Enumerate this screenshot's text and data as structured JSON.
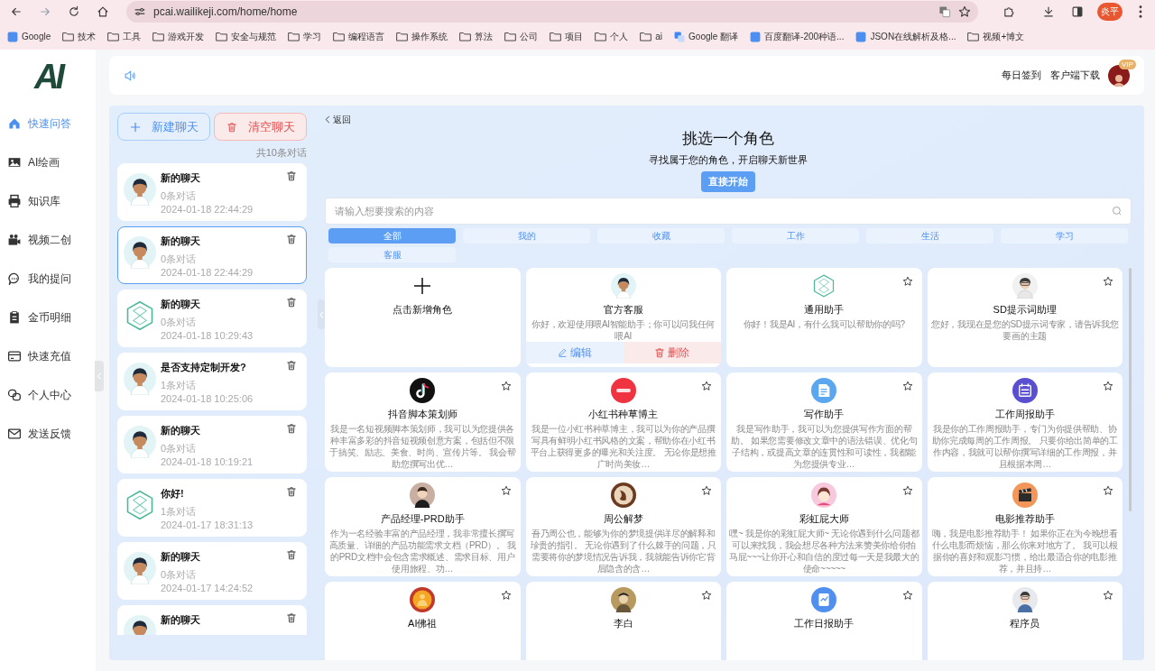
{
  "browser": {
    "url": "pcai.wailikeji.com/home/home",
    "profile": "炎平",
    "bookmarks": [
      {
        "kind": "site",
        "label": "Google"
      },
      {
        "kind": "folder",
        "label": "技术"
      },
      {
        "kind": "folder",
        "label": "工具"
      },
      {
        "kind": "folder",
        "label": "游戏开发"
      },
      {
        "kind": "folder",
        "label": "安全与规范"
      },
      {
        "kind": "folder",
        "label": "学习"
      },
      {
        "kind": "folder",
        "label": "编程语言"
      },
      {
        "kind": "folder",
        "label": "操作系统"
      },
      {
        "kind": "folder",
        "label": "算法"
      },
      {
        "kind": "folder",
        "label": "公司"
      },
      {
        "kind": "folder",
        "label": "项目"
      },
      {
        "kind": "folder",
        "label": "个人"
      },
      {
        "kind": "folder",
        "label": "ai"
      },
      {
        "kind": "translate",
        "label": "Google 翻译"
      },
      {
        "kind": "site",
        "label": "百度翻译-200种语..."
      },
      {
        "kind": "site",
        "label": "JSON在线解析及格..."
      },
      {
        "kind": "folder",
        "label": "视频+博文"
      }
    ]
  },
  "logo": "AI",
  "sidebar": {
    "items": [
      {
        "label": "快速问答",
        "selected": true
      },
      {
        "label": "AI绘画",
        "selected": false
      },
      {
        "label": "知识库",
        "selected": false
      },
      {
        "label": "视频二创",
        "selected": false
      },
      {
        "label": "我的提问",
        "selected": false
      },
      {
        "label": "金币明细",
        "selected": false
      },
      {
        "label": "快速充值",
        "selected": false
      },
      {
        "label": "个人中心",
        "selected": false
      },
      {
        "label": "发送反馈",
        "selected": false
      }
    ]
  },
  "header": {
    "links": [
      "每日签到",
      "客户端下载"
    ],
    "badge": "VIP"
  },
  "chats": {
    "new_button": "新建聊天",
    "clear_button": "清空聊天",
    "count": "共10条对话",
    "items": [
      {
        "title": "新的聊天",
        "messages": "0条对话",
        "time": "2024-01-18 22:44:29",
        "selected": false
      },
      {
        "title": "新的聊天",
        "messages": "0条对话",
        "time": "2024-01-18 22:44:29",
        "selected": true
      },
      {
        "title": "新的聊天",
        "messages": "0条对话",
        "time": "2024-01-18 10:29:43",
        "selected": false
      },
      {
        "title": "是否支持定制开发?",
        "messages": "1条对话",
        "time": "2024-01-18 10:25:06",
        "selected": false
      },
      {
        "title": "新的聊天",
        "messages": "0条对话",
        "time": "2024-01-18 10:19:21",
        "selected": false
      },
      {
        "title": "你好!",
        "messages": "1条对话",
        "time": "2024-01-17 18:31:13",
        "selected": false
      },
      {
        "title": "新的聊天",
        "messages": "0条对话",
        "time": "2024-01-17 14:24:52",
        "selected": false
      },
      {
        "title": "新的聊天",
        "selected": false
      }
    ]
  },
  "roles": {
    "back": "返回",
    "title": "挑选一个角色",
    "subtitle": "寻找属于您的角色，开启聊天新世界",
    "start_button": "直接开始",
    "search": {
      "placeholder": "请输入想要搜索的内容"
    },
    "tabs": [
      {
        "label": "全部",
        "selected": true
      },
      {
        "label": "我的",
        "selected": false
      },
      {
        "label": "收藏",
        "selected": false
      },
      {
        "label": "工作",
        "selected": false
      },
      {
        "label": "生活",
        "selected": false
      },
      {
        "label": "学习",
        "selected": false
      },
      {
        "label": "客服",
        "selected": false
      }
    ],
    "cards": [
      {
        "kind": "add",
        "title": "点击新增角色"
      },
      {
        "kind": "role",
        "title": "官方客服",
        "description": "你好，欢迎使用喂AI智能助手；你可以问我任何喂AI",
        "hovered": true,
        "actions": [
          "编辑",
          "删除"
        ]
      },
      {
        "kind": "role",
        "title": "通用助手",
        "description": "你好！我是AI，有什么我可以帮助你的吗?",
        "hovered": false
      },
      {
        "kind": "role",
        "title": "SD提示词助理",
        "description": "您好，我现在是您的SD提示词专家，请告诉我您要画的主题",
        "hovered": false
      },
      {
        "kind": "role",
        "title": "抖音脚本策划师",
        "description": "我是一名短视频脚本策划师，我可以为您提供各种丰富多彩的抖音短视频创意方案，包括但不限于搞笑、励志、美食、时尚、宣传片等。 我会帮助您撰写出优…",
        "hovered": false
      },
      {
        "kind": "role",
        "title": "小红书种草博主",
        "description": "我是一位小红书种草博主，我可以为你的产品撰写具有鲜明小红书风格的文案，帮助你在小红书平台上获得更多的曝光和关注度。 无论你是想推广时尚美妆…",
        "hovered": false
      },
      {
        "kind": "role",
        "title": "写作助手",
        "description": "我是写作助手，我可以为您提供写作方面的帮助。 如果您需要修改文章中的语法错误、优化句子结构，或提高文章的连贯性和可读性，我都能为您提供专业…",
        "hovered": false
      },
      {
        "kind": "role",
        "title": "工作周报助手",
        "description": "我是你的工作周报助手，专门为你提供帮助、协助你完成每周的工作周报。 只要你给出简单的工作内容，我就可以帮你撰写详细的工作周报，并且根据本周…",
        "hovered": false
      },
      {
        "kind": "role",
        "title": "产品经理-PRD助手",
        "description": "作为一名经验丰富的产品经理，我非常擅长撰写高质量、详细的产品功能需求文档（PRD）。 我的PRD文档中会包含需求概述、需求目标、用户使用旅程、功…",
        "hovered": false
      },
      {
        "kind": "role",
        "title": "周公解梦",
        "description": "吾乃周公也，能够为你的梦境提供详尽的解释和珍贵的指引。 无论你遇到了什么棘手的问题，只需要将你的梦境情况告诉我，我就能告诉你它背后隐含的含…",
        "hovered": false
      },
      {
        "kind": "role",
        "title": "彩虹屁大师",
        "description": "嘿~ 我是你的彩虹屁大师~ 无论你遇到什么问题都可以来找我，我会想尽各种方法来赞美你给你拍马屁~~~让你开心和自信的度过每一天是我最大的使命~~~~~",
        "hovered": false
      },
      {
        "kind": "role",
        "title": "电影推荐助手",
        "description": "嗨，我是电影推荐助手！ 如果你正在为今晚想看什么电影而烦恼，那么你来对地方了。 我可以根据你的喜好和观影习惯，给出最适合你的电影推荐，并且持…",
        "hovered": false
      },
      {
        "kind": "role",
        "title": "AI佛祖",
        "hovered": false
      },
      {
        "kind": "role",
        "title": "李白",
        "hovered": false
      },
      {
        "kind": "role",
        "title": "工作日报助手",
        "hovered": false
      },
      {
        "kind": "role",
        "title": "程序员",
        "hovered": false
      }
    ]
  }
}
